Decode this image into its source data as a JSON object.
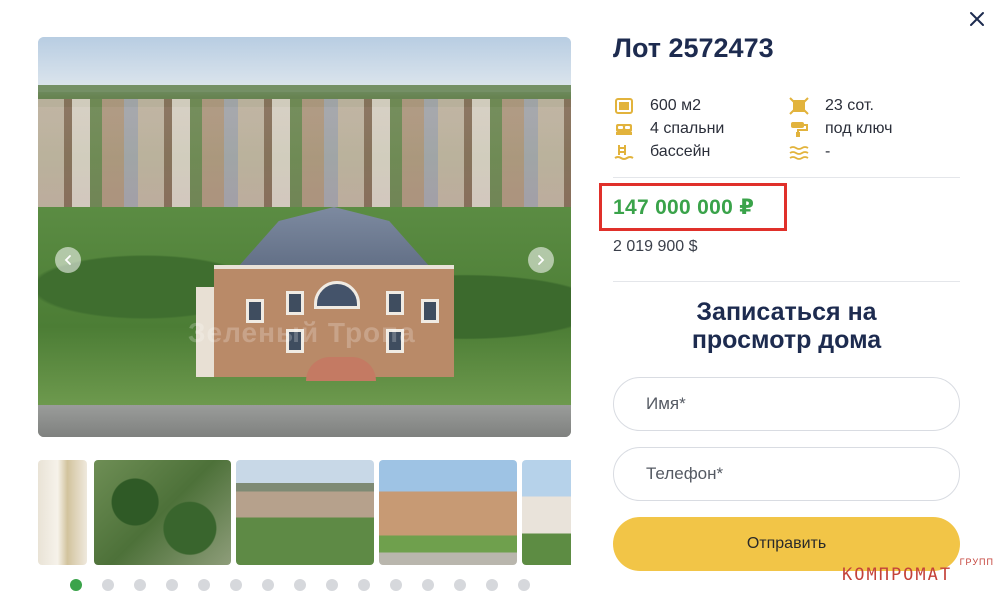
{
  "listing": {
    "title": "Лот 2572473",
    "specs": [
      {
        "icon": "area-icon",
        "value": "600 м2"
      },
      {
        "icon": "bed-icon",
        "value": "4 спальни"
      },
      {
        "icon": "pool-ladder-icon",
        "value": "бассейн"
      },
      {
        "icon": "plot-icon",
        "value": "23 сот."
      },
      {
        "icon": "paint-roller-icon",
        "value": "под ключ"
      },
      {
        "icon": "water-waves-icon",
        "value": "-"
      }
    ],
    "price_rub": "147 000 000 ₽",
    "price_usd": "2 019 900 $"
  },
  "gallery": {
    "main_watermark": "Зеленый Тропа",
    "thumbnail_count": 5,
    "dot_count": 15,
    "active_dot": 0
  },
  "form": {
    "title_line1": "Записаться на",
    "title_line2": "просмотр дома",
    "name_placeholder": "Имя*",
    "phone_placeholder": "Телефон*",
    "submit_label": "Отправить"
  },
  "watermark": {
    "main": "КОМПРОМАТ",
    "sub": "ГРУПП"
  },
  "colors": {
    "accent_green": "#3aa34a",
    "navy": "#1d2b4f",
    "button_yellow": "#f2c547",
    "highlight_red": "#e0302a",
    "icon_gold": "#e2b33c"
  }
}
